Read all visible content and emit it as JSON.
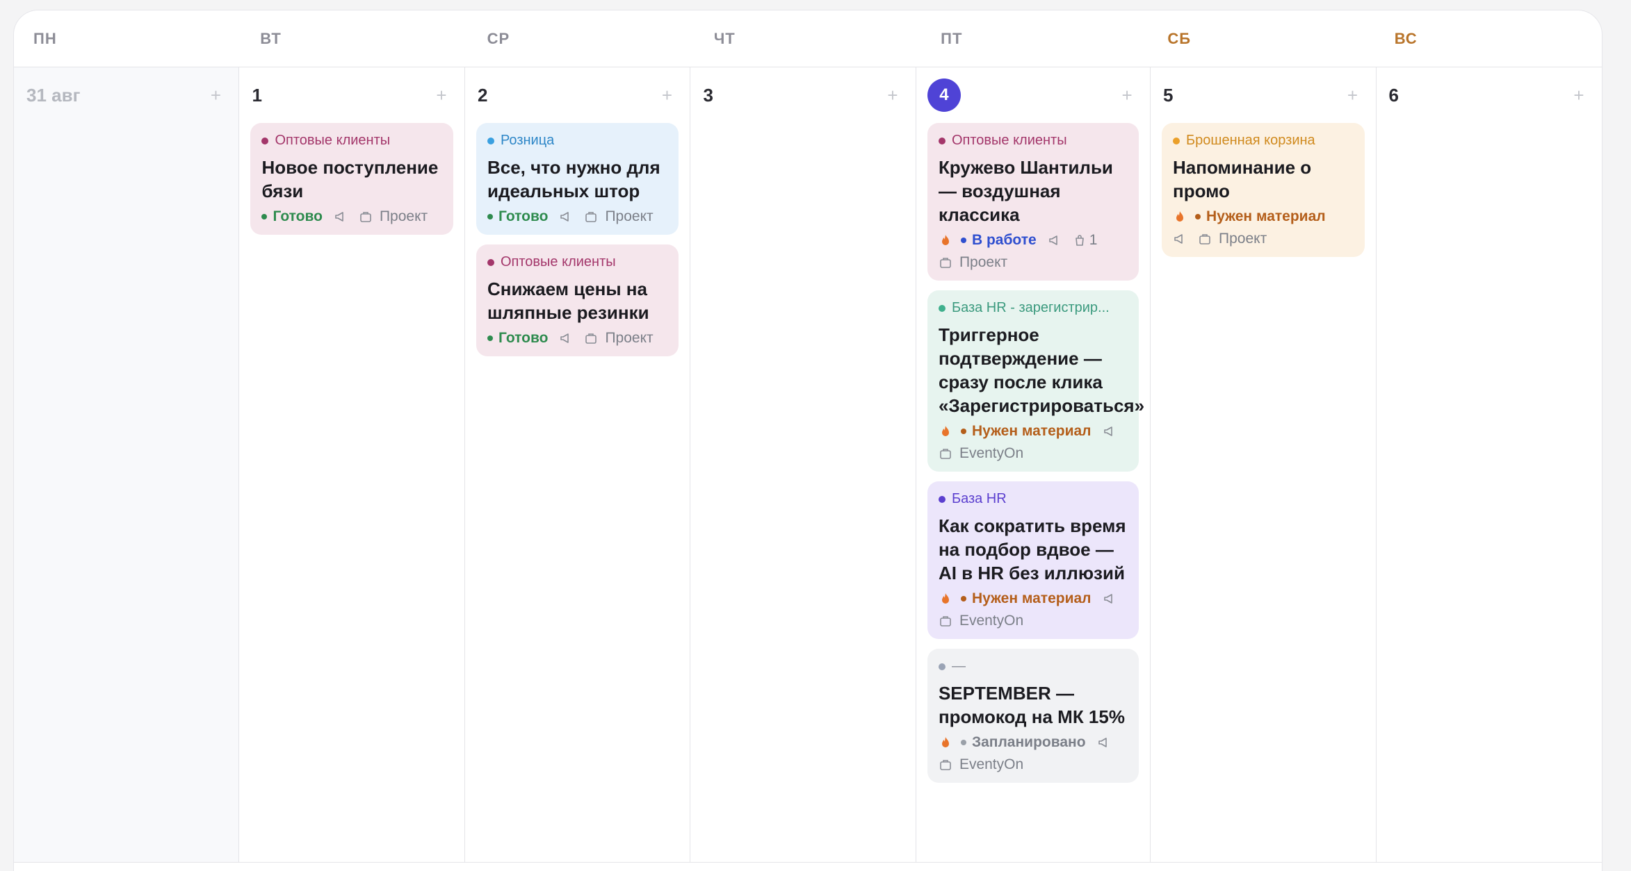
{
  "weekdays": [
    "ПН",
    "ВТ",
    "СР",
    "ЧТ",
    "ПТ",
    "СБ",
    "ВС"
  ],
  "days": [
    "31 авг",
    "1",
    "2",
    "3",
    "4",
    "5",
    "6"
  ],
  "add_label": "+",
  "colors": {
    "accent": "#4f43d6",
    "weekend_header": "#b8742a",
    "ready": "#2e8b4e",
    "in_work": "#2f4fcf",
    "need_material": "#b45e1a"
  },
  "cards": {
    "d1": [
      {
        "segment": "Оптовые клиенты",
        "title": "Новое поступление бязи",
        "status": "Готово",
        "project": "Проект"
      }
    ],
    "d2": [
      {
        "segment": "Розница",
        "title": "Все, что нужно для идеальных штор",
        "status": "Готово",
        "project": "Проект"
      },
      {
        "segment": "Оптовые клиенты",
        "title": "Снижаем цены на шляпные резинки",
        "status": "Готово",
        "project": "Проект"
      }
    ],
    "d4": [
      {
        "segment": "Оптовые клиенты",
        "title": "Кружево Шантильи — воздушная классика",
        "status": "В работе",
        "count": "1",
        "project": "Проект"
      },
      {
        "segment": "База HR - зарегистрир...",
        "title": "Триггерное подтверждение — сразу после клика «Зарегистрироваться»",
        "status": "Нужен материал",
        "project": "EventyOn"
      },
      {
        "segment": "База HR",
        "title": "Как сократить время на подбор вдвое — AI в HR без иллюзий",
        "status": "Нужен материал",
        "project": "EventyOn"
      },
      {
        "segment": "—",
        "title": "SEPTEMBER — промокод на МК 15%",
        "status": "Запланировано",
        "project": "EventyOn"
      }
    ],
    "d5": [
      {
        "segment": "Брошенная корзина",
        "title": "Напоминание о промо",
        "status": "Нужен материал",
        "project": "Проект"
      }
    ]
  },
  "icons": [
    "plus-icon",
    "flame-icon",
    "megaphone-icon",
    "briefcase-icon",
    "bag-icon"
  ]
}
